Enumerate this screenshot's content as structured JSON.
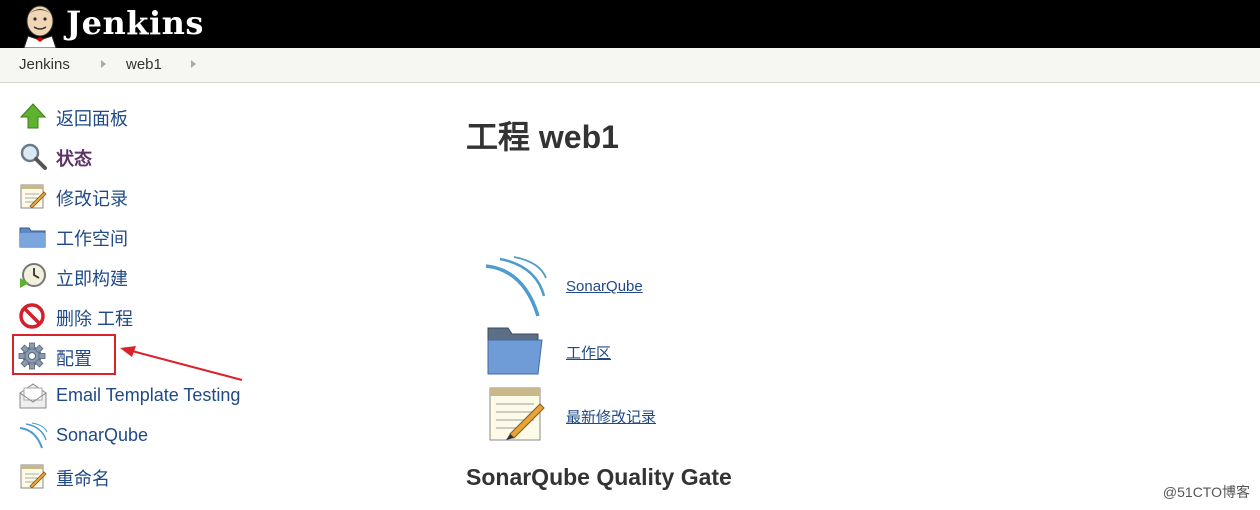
{
  "header": {
    "brand": "Jenkins",
    "logo": "jenkins-butler-logo"
  },
  "breadcrumb": [
    "Jenkins",
    "web1"
  ],
  "sidebar": {
    "items": [
      {
        "label": "返回面板",
        "icon": "up-arrow-icon"
      },
      {
        "label": "状态",
        "icon": "magnifier-icon",
        "active": true
      },
      {
        "label": "修改记录",
        "icon": "notepad-icon"
      },
      {
        "label": "工作空间",
        "icon": "folder-icon"
      },
      {
        "label": "立即构建",
        "icon": "clock-play-icon"
      },
      {
        "label": "删除 工程",
        "icon": "no-entry-icon"
      },
      {
        "label": "配置",
        "icon": "gear-icon"
      },
      {
        "label": "Email Template Testing",
        "icon": "envelope-icon"
      },
      {
        "label": "SonarQube",
        "icon": "sonarqube-icon"
      },
      {
        "label": "重命名",
        "icon": "notepad-icon"
      }
    ]
  },
  "main": {
    "title": "工程 web1",
    "links": [
      {
        "label": "SonarQube",
        "icon": "sonarqube-icon"
      },
      {
        "label": "工作区",
        "icon": "folder-icon"
      },
      {
        "label": "最新修改记录",
        "icon": "notepad-icon"
      }
    ],
    "section_heading": "SonarQube Quality Gate"
  },
  "watermark": "@51CTO博客",
  "colors": {
    "link": "#204a87",
    "active": "#5c3566",
    "highlight": "#d9232a"
  }
}
